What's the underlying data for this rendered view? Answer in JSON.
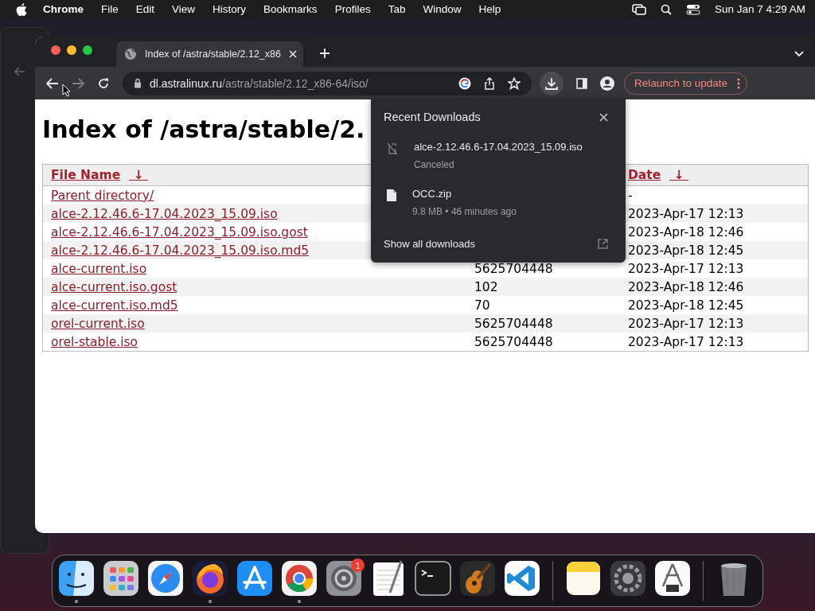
{
  "menu_bar": {
    "app": "Chrome",
    "items": [
      "File",
      "Edit",
      "View",
      "History",
      "Bookmarks",
      "Profiles",
      "Tab",
      "Window",
      "Help"
    ],
    "clock": "Sun Jan 7  4:29 AM"
  },
  "browser": {
    "tabs": [
      {
        "title": "Index of /astra/stable/2.12_x86",
        "selected": true
      }
    ],
    "url": {
      "domain": "dl.astralinux.ru",
      "path": "/astra/stable/2.12_x86-64/iso/"
    },
    "relaunch_button": "Relaunch to update"
  },
  "page": {
    "heading": "Index of /astra/stable/2.",
    "table": {
      "name_header": {
        "label": "File Name",
        "sort": "↓"
      },
      "date_header": {
        "label": "Date",
        "sort": "↓"
      },
      "rows": [
        {
          "name": "Parent directory/",
          "date": "-"
        },
        {
          "name": "alce-2.12.46.6-17.04.2023_15.09.iso",
          "date": "2023-Apr-17 12:13"
        },
        {
          "name": "alce-2.12.46.6-17.04.2023_15.09.iso.gost",
          "date": "2023-Apr-18 12:46"
        },
        {
          "name": "alce-2.12.46.6-17.04.2023_15.09.iso.md5",
          "date": "2023-Apr-18 12:45"
        },
        {
          "name": "alce-current.iso",
          "size": "5625704448",
          "date": "2023-Apr-17 12:13"
        },
        {
          "name": "alce-current.iso.gost",
          "size": "102",
          "date": "2023-Apr-18 12:46"
        },
        {
          "name": "alce-current.iso.md5",
          "size": "70",
          "date": "2023-Apr-18 12:45"
        },
        {
          "name": "orel-current.iso",
          "size": "5625704448",
          "date": "2023-Apr-17 12:13"
        },
        {
          "name": "orel-stable.iso",
          "size": "5625704448",
          "date": "2023-Apr-17 12:13"
        }
      ]
    }
  },
  "downloads_popup": {
    "title": "Recent Downloads",
    "items": [
      {
        "kind": "canceled",
        "name": "alce-2.12.46.6-17.04.2023_15.09.iso",
        "status": "Canceled"
      },
      {
        "kind": "file",
        "name": "OCC.zip",
        "status": "9.8 MB • 46 minutes ago"
      }
    ],
    "footer": "Show all downloads"
  },
  "dock": {
    "groups": [
      [
        {
          "kind": "finder",
          "running": true
        },
        {
          "kind": "launchpad",
          "running": false
        },
        {
          "kind": "safari",
          "running": false
        },
        {
          "kind": "firefox",
          "running": true
        },
        {
          "kind": "appstore",
          "running": false
        },
        {
          "kind": "chrome",
          "running": true
        },
        {
          "kind": "settings",
          "running": false,
          "badge": "1"
        },
        {
          "kind": "textedit",
          "running": false
        },
        {
          "kind": "terminal",
          "running": false
        },
        {
          "kind": "garageband",
          "running": false
        },
        {
          "kind": "vscode",
          "running": false
        }
      ],
      [
        {
          "kind": "notes",
          "running": false
        },
        {
          "kind": "compressor",
          "running": false
        },
        {
          "kind": "calipers",
          "running": false
        }
      ],
      [
        {
          "kind": "trash",
          "running": false
        }
      ]
    ]
  }
}
